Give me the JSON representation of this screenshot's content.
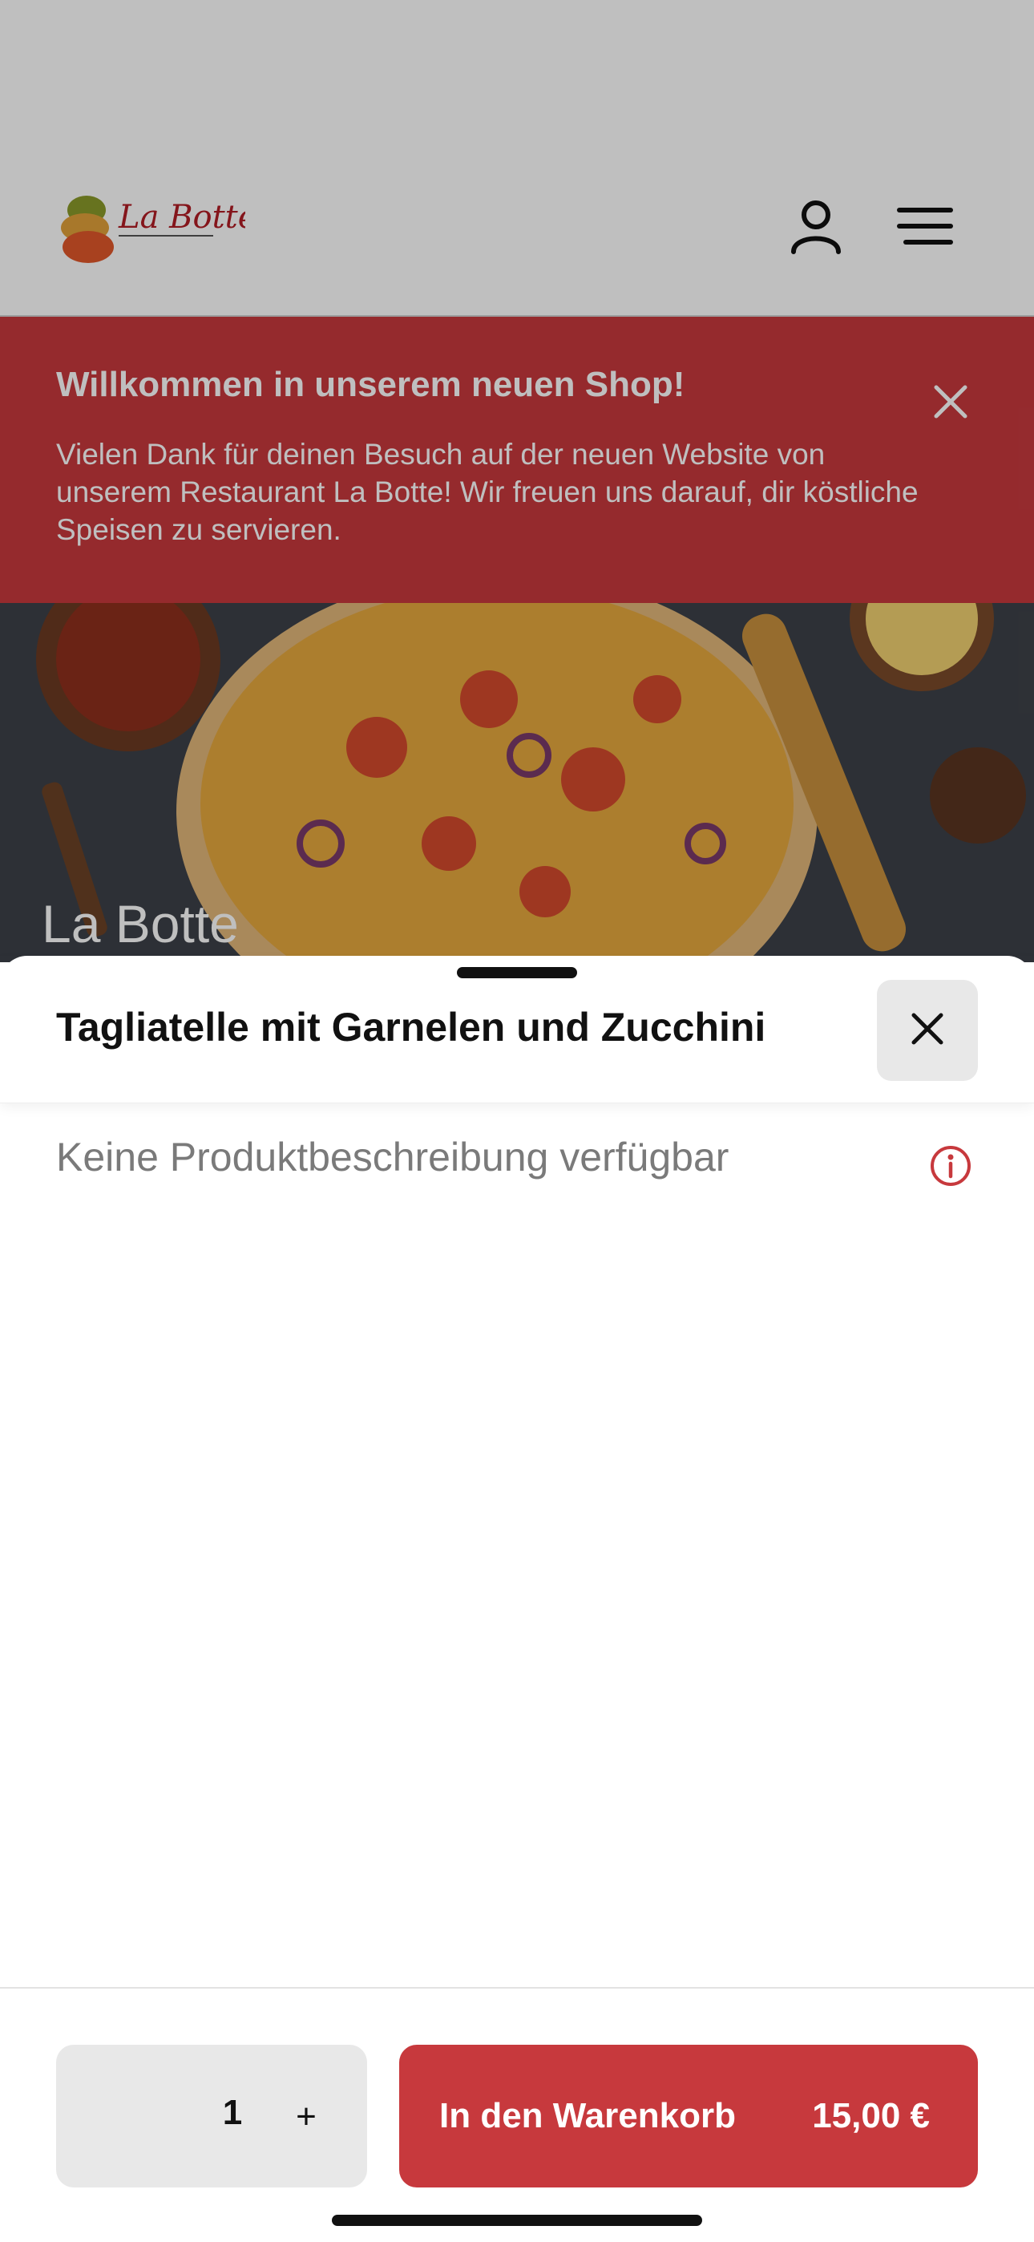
{
  "header": {
    "logo_icon": "la-botte-logo",
    "user_icon": "user-icon",
    "menu_icon": "hamburger-menu-icon"
  },
  "banner": {
    "title": "Willkommen in unserem neuen Shop!",
    "text": "Vielen Dank für deinen Besuch auf der neuen Website von unserem Restaurant La Botte! Wir freuen uns darauf, dir köstliche Speisen zu servieren.",
    "close_icon": "close-icon",
    "bg_color": "#c7393d"
  },
  "hero": {
    "title": "La Botte"
  },
  "sheet": {
    "title": "Tagliatelle mit Garnelen und Zucchini",
    "close_icon": "close-icon",
    "description": "Keine Produktbeschreibung verfügbar",
    "info_icon": "info-icon",
    "info_color": "#c7393d"
  },
  "footer": {
    "quantity": "1",
    "plus_label": "+",
    "add_label": "In den Warenkorb",
    "price": "15,00 €",
    "accent": "#c7393d"
  }
}
